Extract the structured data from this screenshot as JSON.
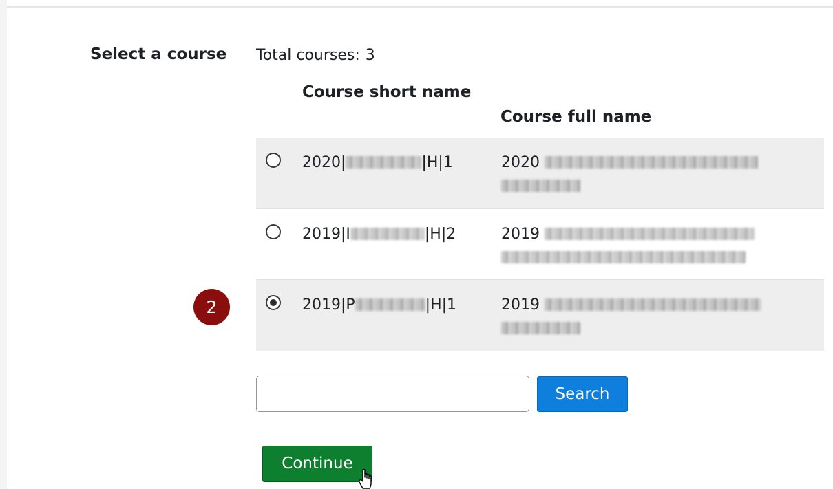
{
  "form": {
    "label": "Select a course",
    "total_label": "Total courses:",
    "total_count": "3"
  },
  "table": {
    "columns": [
      "Course short name",
      "Course full name"
    ],
    "rows": [
      {
        "short_prefix": "2020|",
        "short_suffix": "|H|1",
        "full_prefix": "2020",
        "full_suffix": "",
        "selected": false
      },
      {
        "short_prefix": "2019|I",
        "short_suffix": "|H|2",
        "full_prefix": "2019",
        "full_suffix": "",
        "selected": false
      },
      {
        "short_prefix": "2019|P",
        "short_suffix": "|H|1",
        "full_prefix": "2019",
        "full_suffix": "",
        "selected": true
      }
    ]
  },
  "badge": {
    "number": "2"
  },
  "search": {
    "placeholder": "",
    "value": "",
    "button_label": "Search"
  },
  "actions": {
    "continue_label": "Continue"
  },
  "colors": {
    "badge": "#8b0e0e",
    "search_button": "#0f7fdd",
    "continue_button": "#0e7f2e",
    "row_shade": "#eeeeee"
  },
  "icons": [
    "radio-unchecked-icon",
    "radio-checked-icon",
    "hand-pointer-cursor-icon"
  ]
}
